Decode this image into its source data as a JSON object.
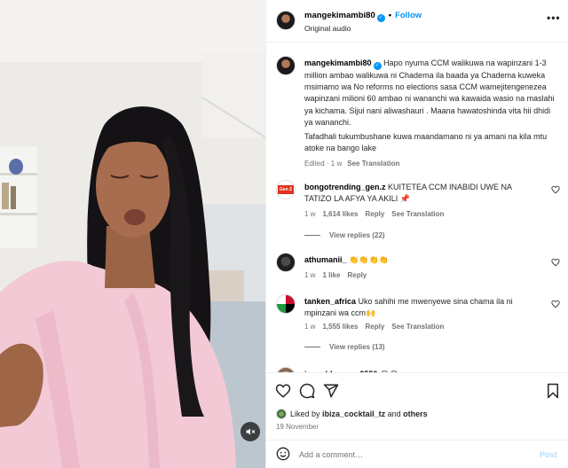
{
  "header": {
    "username": "mangekimambi80",
    "follow_label": "Follow",
    "subtitle": "Original audio",
    "more_label": "•••"
  },
  "caption": {
    "username": "mangekimambi80",
    "text": "Hapo nyuma CCM walikuwa na wapinzani 1-3 million ambao walikuwa ni Chadema ila baada ya Chadema kuweka msimamo wa No reforms no elections sasa CCM wamejitengenezea wapinzani milioni 60 ambao ni wananchi wa kawaida wasio na maslahi ya kichama. Sijui nani aliwashauri . Maana hawatoshinda vita hii dhidi ya wananchi.",
    "text2": "Tafadhali tukumbushane kuwa maandamano ni ya amani na kila mtu atoke na bango lake",
    "edited": "Edited · 1 w",
    "see_translation": "See Translation"
  },
  "comments": [
    {
      "username": "bongotrending_gen.z",
      "avatar_text": "Gen Z",
      "text": "KUITETEA CCM INABIDI UWE NA TATIZO LA AFYA YA AKILI 📌",
      "age": "1 w",
      "likes": "1,614 likes",
      "reply": "Reply",
      "see_translation": "See Translation",
      "view_replies": "View replies (22)"
    },
    {
      "username": "athumanii_",
      "text": "👏👏👏👏",
      "age": "1 w",
      "likes": "1 like",
      "reply": "Reply"
    },
    {
      "username": "tanken_africa",
      "text": "Uko sahihi me mwenyewe sina chama ila ni mpinzani wa ccm🙌",
      "age": "1 w",
      "likes": "1,555 likes",
      "reply": "Reply",
      "see_translation": "See Translation",
      "view_replies": "View replies (13)"
    },
    {
      "username": "josephkawogo9550",
      "text": "😂😂"
    }
  ],
  "likes": {
    "prefix": "Liked by",
    "user": "ibiza_cocktail_tz",
    "and": "and",
    "others": "others"
  },
  "date": "19 November",
  "add_comment": {
    "placeholder": "Add a comment…",
    "post_label": "Post"
  },
  "icons": {
    "like": "heart-icon",
    "comment": "comment-icon",
    "share": "share-icon",
    "save": "bookmark-icon",
    "mute": "speaker-muted-icon",
    "emoji": "emoji-icon"
  },
  "colors": {
    "accent": "#0095f6",
    "post_disabled": "#b3dbff",
    "muted_text": "#737373"
  }
}
